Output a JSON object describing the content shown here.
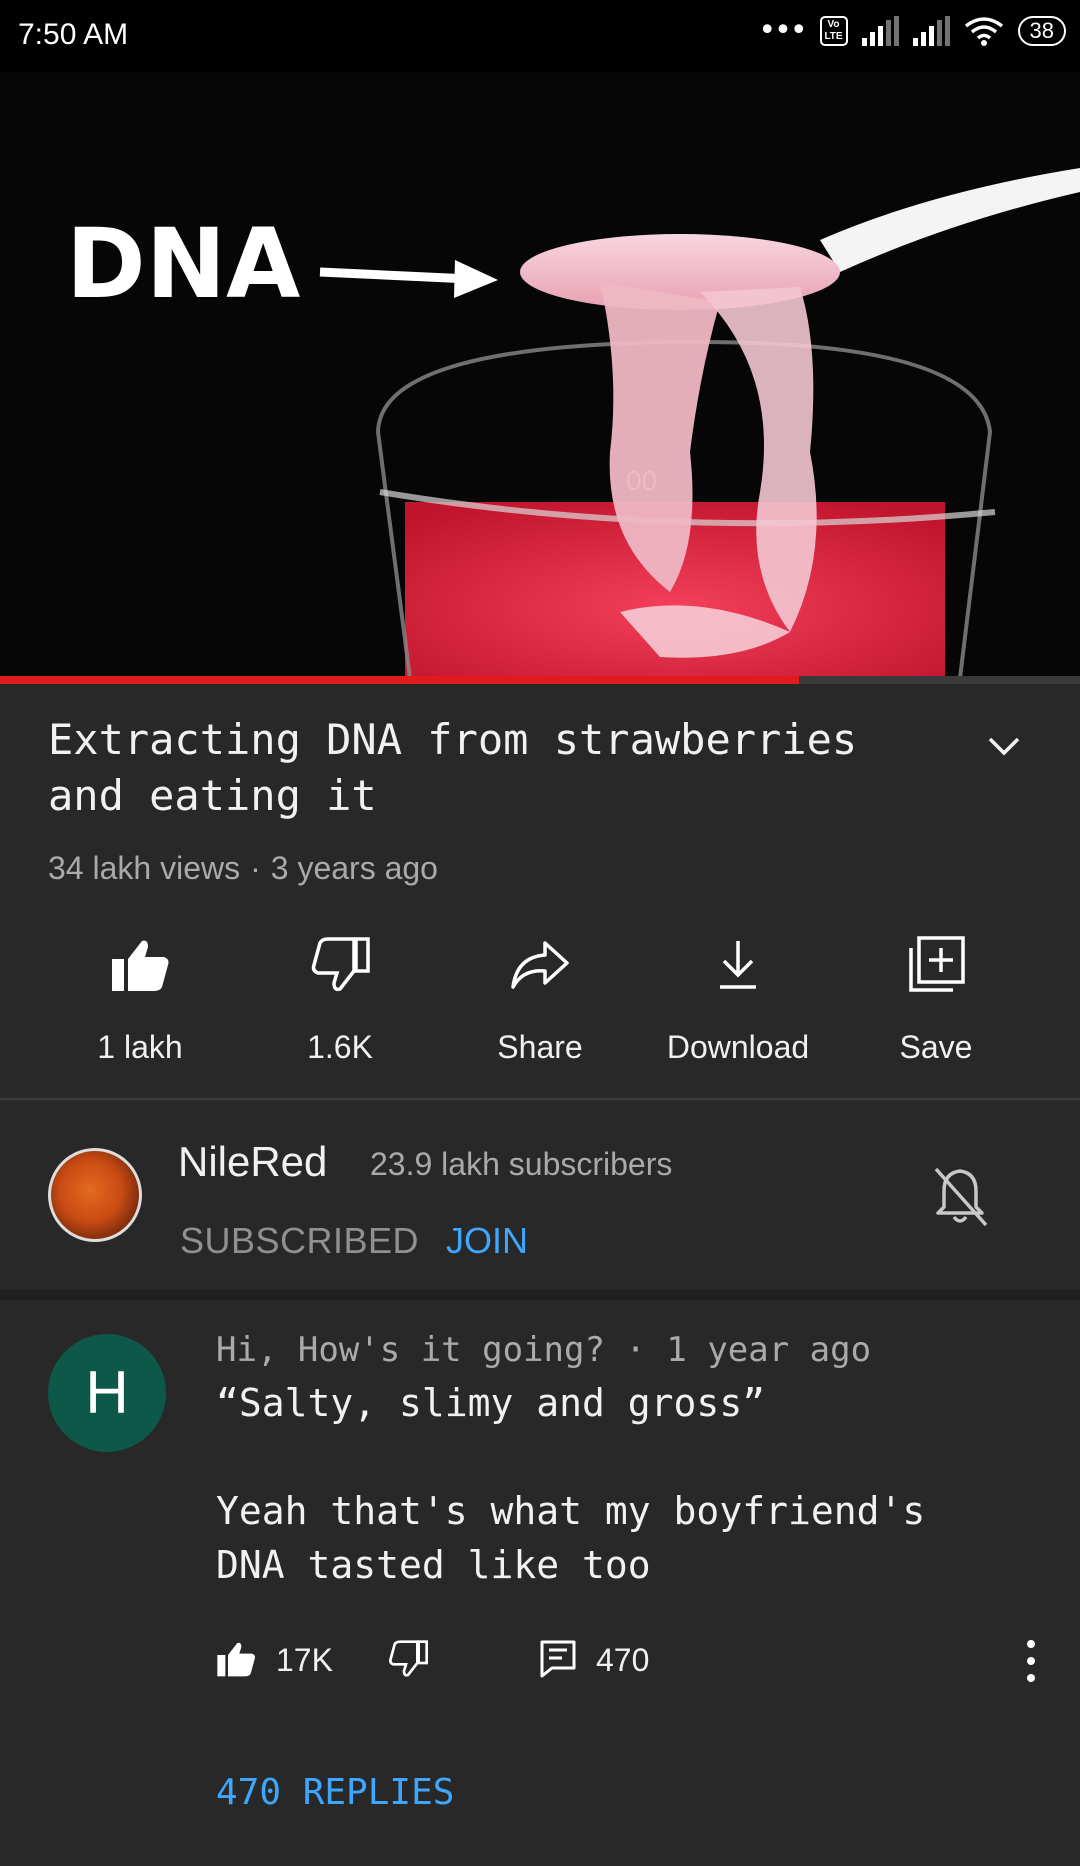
{
  "status_bar": {
    "time": "7:50 AM",
    "volte": "Vo LTE",
    "battery": "38"
  },
  "video": {
    "overlay_text": "DNA",
    "beaker_marking": "00",
    "progress": 0.74,
    "progress_color": "#e01b1b"
  },
  "title": "Extracting DNA from strawberries and eating it",
  "meta": {
    "views": "34 lakh views",
    "separator": "·",
    "age": "3 years ago"
  },
  "actions": [
    {
      "label": "1 lakh",
      "icon": "thumbs-up-icon"
    },
    {
      "label": "1.6K",
      "icon": "thumbs-down-icon"
    },
    {
      "label": "Share",
      "icon": "share-icon"
    },
    {
      "label": "Download",
      "icon": "download-icon"
    },
    {
      "label": "Save",
      "icon": "add-to-playlist-icon"
    }
  ],
  "channel": {
    "name": "NileRed",
    "subscribers": "23.9 lakh subscribers",
    "subscribed_label": "SUBSCRIBED",
    "join_label": "JOIN",
    "bell_icon": "notifications-off-icon"
  },
  "comment": {
    "avatar_letter": "H",
    "avatar_color": "#0e5849",
    "author": "Hi, How's it going?",
    "separator": "·",
    "age": "1 year ago",
    "text": "“Salty, slimy and gross”\n\nYeah that's what my boyfriend's DNA tasted like too",
    "likes": "17K",
    "replies_count": "470",
    "replies_link": "470 REPLIES"
  },
  "colors": {
    "background": "#282828",
    "accent_link": "#3ea6ff",
    "secondary_text": "#aaaaaa"
  }
}
